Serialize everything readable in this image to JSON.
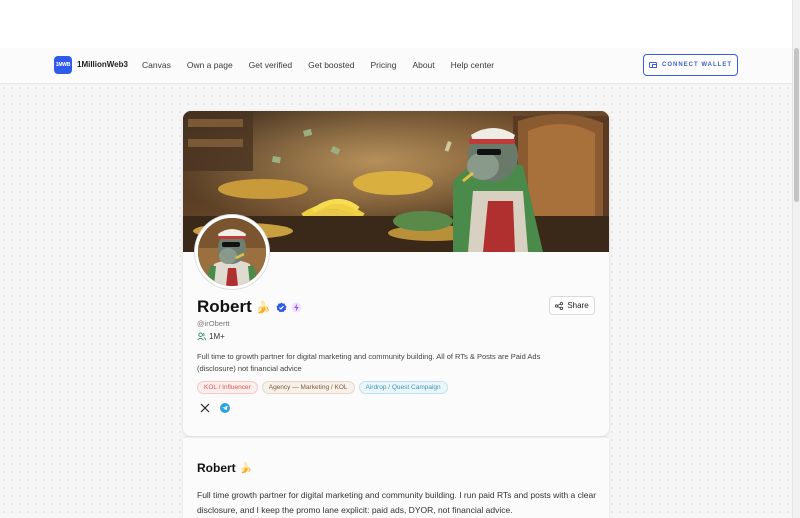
{
  "nav": {
    "logo_text": "1MWB",
    "brand": "1MillionWeb3",
    "links": [
      "Canvas",
      "Own a page",
      "Get verified",
      "Get boosted",
      "Pricing",
      "About",
      "Help center"
    ],
    "connect_label": "CONNECT WALLET",
    "accent_color": "#3a5de0"
  },
  "profile": {
    "name": "Robert",
    "name_emoji": "🍌",
    "verified": true,
    "boosted": true,
    "handle": "@irObertt",
    "followers": "1M+",
    "bio": "Full time to growth partner for digital marketing and community building. All of RTs & Posts are Paid Ads (disclosure) not financial advice",
    "tags": [
      "KOL / Influencer",
      "Agency — Marketing / KOL",
      "Airdrop / Quest Campaign"
    ],
    "share_label": "Share",
    "socials": [
      "x-icon",
      "telegram-icon"
    ]
  },
  "about": {
    "name": "Robert",
    "name_emoji": "🍌",
    "text": "Full time growth partner for digital marketing and community building. I run paid RTs and posts with a clear disclosure, and I keep the promo lane explicit: paid ads, DYOR, not financial advice."
  }
}
